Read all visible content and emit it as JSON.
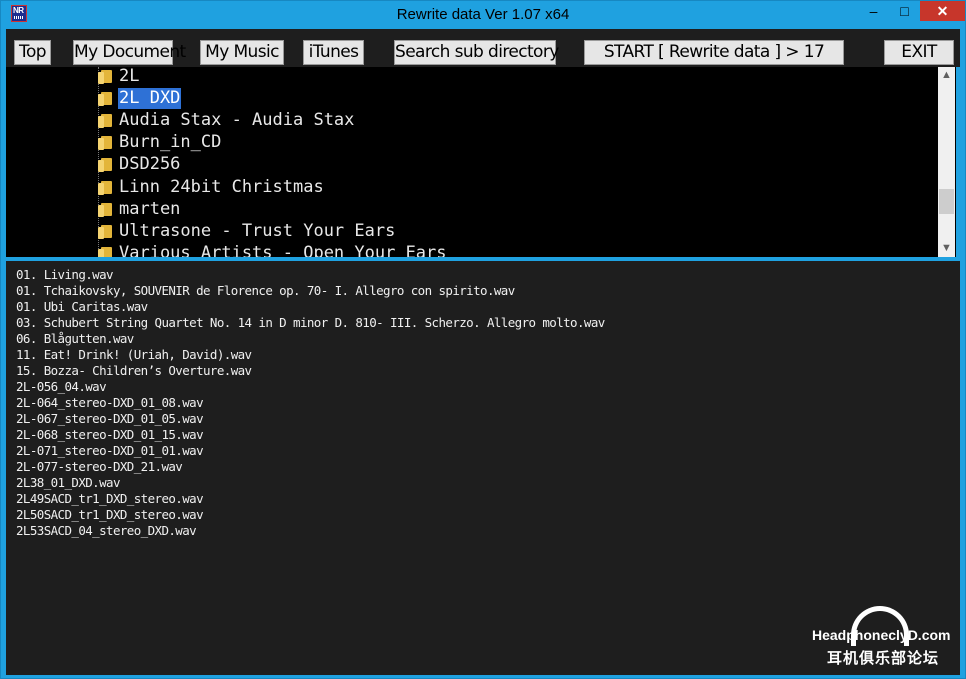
{
  "window": {
    "title": "Rewrite data  Ver 1.07  x64",
    "app_icon_text": "NR",
    "minimize": "–",
    "maximize": "□",
    "close": "✕"
  },
  "toolbar": {
    "top": "Top",
    "my_document": "My Document",
    "my_music": "My Music",
    "itunes": "iTunes",
    "search_sub": "Search sub directory",
    "start": "START [ Rewrite data ] > 17",
    "exit": "EXIT"
  },
  "tree": {
    "items": [
      {
        "label": "2L",
        "selected": false
      },
      {
        "label": "2L DXD",
        "selected": true
      },
      {
        "label": "Audia Stax - Audia Stax",
        "selected": false
      },
      {
        "label": "Burn_in_CD",
        "selected": false
      },
      {
        "label": "DSD256",
        "selected": false
      },
      {
        "label": "Linn 24bit Christmas",
        "selected": false
      },
      {
        "label": "marten",
        "selected": false
      },
      {
        "label": "Ultrasone - Trust Your Ears",
        "selected": false
      },
      {
        "label": "Various Artists - Open Your Ears",
        "selected": false
      }
    ],
    "scroll_up": "▲",
    "scroll_down": "▼"
  },
  "files": [
    "01. Living.wav",
    "01. Tchaikovsky, SOUVENIR de Florence op. 70- I. Allegro con spirito.wav",
    "01. Ubi Caritas.wav",
    "03. Schubert String Quartet No. 14 in D minor D. 810- III. Scherzo. Allegro molto.wav",
    "06. Blågutten.wav",
    "11. Eat! Drink! (Uriah, David).wav",
    "15. Bozza- Children’s Overture.wav",
    "2L-056_04.wav",
    "2L-064_stereo-DXD_01_08.wav",
    "2L-067_stereo-DXD_01_05.wav",
    "2L-068_stereo-DXD_01_15.wav",
    "2L-071_stereo-DXD_01_01.wav",
    "2L-077-stereo-DXD_21.wav",
    "2L38_01_DXD.wav",
    "2L49SACD_tr1_DXD_stereo.wav",
    "2L50SACD_tr1_DXD_stereo.wav",
    "2L53SACD_04_stereo_DXD.wav"
  ],
  "watermark": {
    "brand": "HeadphoneclуD.com",
    "cn": "耳机俱乐部论坛"
  },
  "colors": {
    "title_bar": "#1fa1e0",
    "close_button": "#c7362b",
    "selection": "#2e71d6",
    "panel_background": "#1e1e1e",
    "folder": "#e3b53a"
  }
}
